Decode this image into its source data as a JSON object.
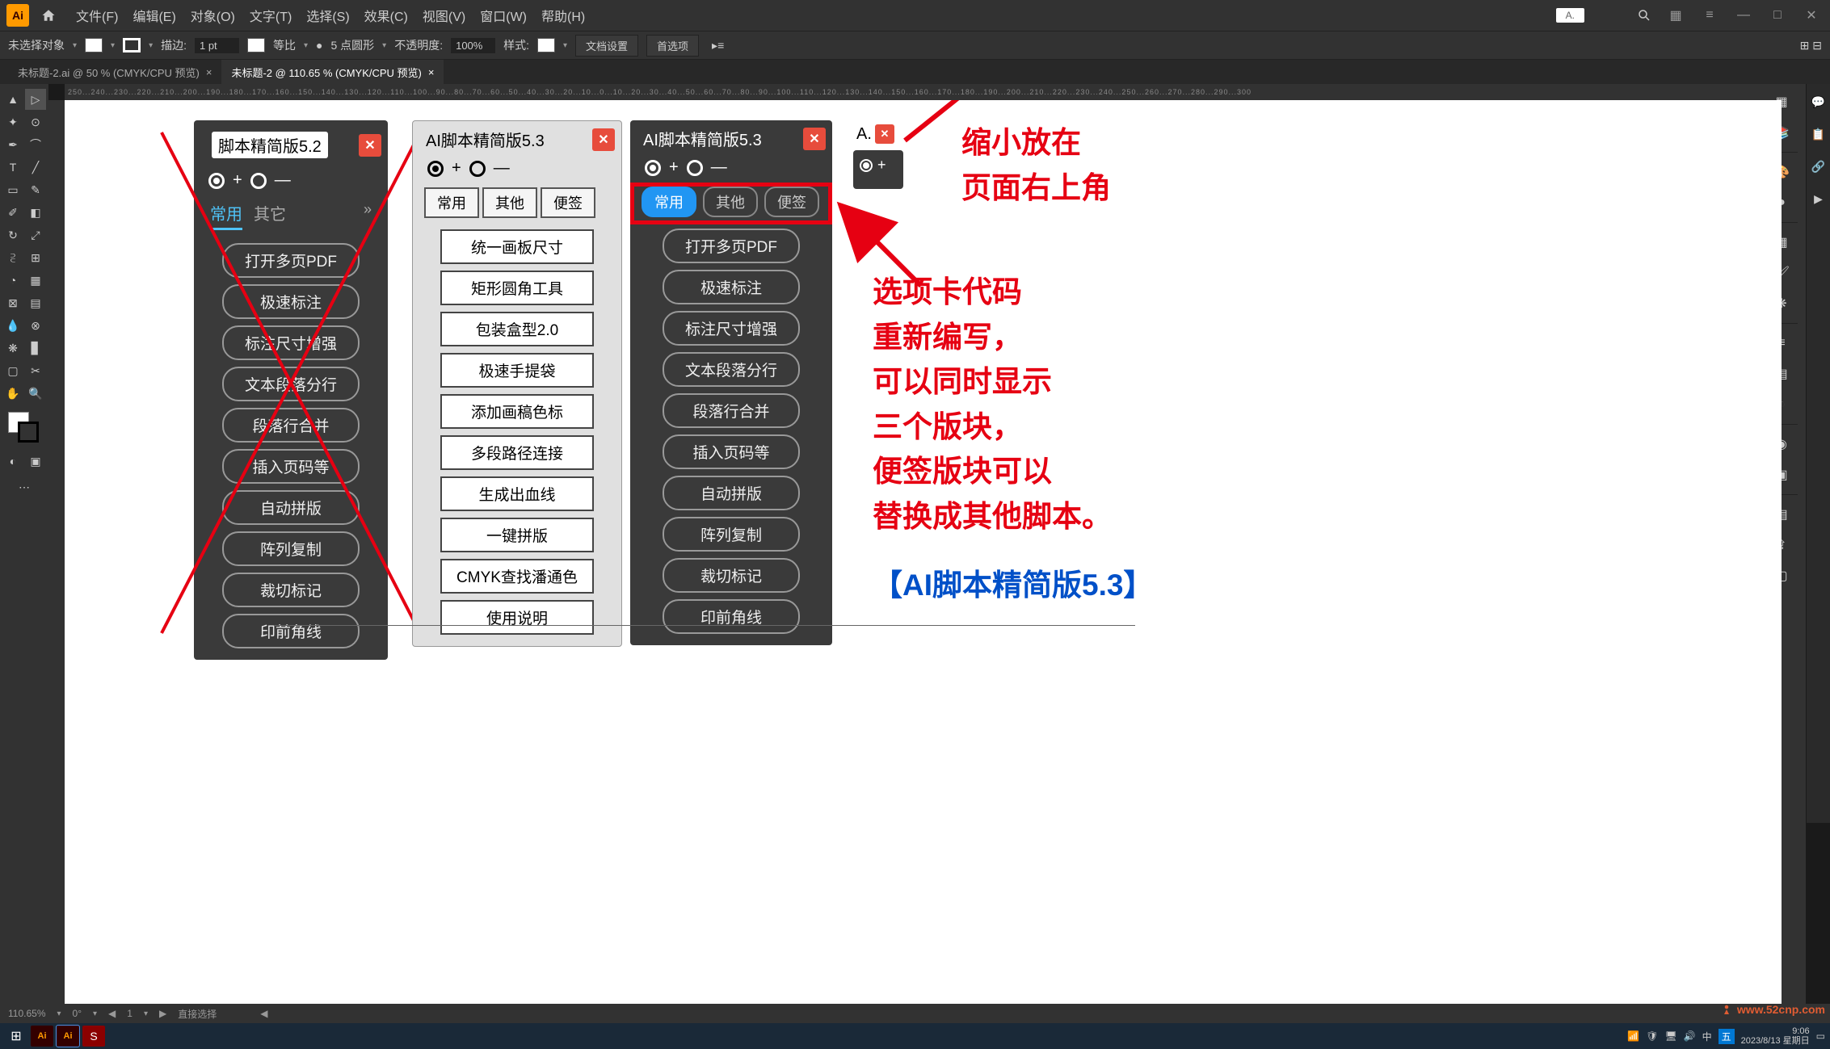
{
  "menubar": {
    "items": [
      "文件(F)",
      "编辑(E)",
      "对象(O)",
      "文字(T)",
      "选择(S)",
      "效果(C)",
      "视图(V)",
      "窗口(W)",
      "帮助(H)"
    ],
    "mini_label": "A."
  },
  "controlbar": {
    "noselection": "未选择对象",
    "stroke_label": "描边:",
    "stroke_val": "1 pt",
    "uniform": "等比",
    "brush_label": "5 点圆形",
    "opacity_label": "不透明度:",
    "opacity_val": "100%",
    "style_label": "样式:",
    "doc_settings": "文档设置",
    "prefs": "首选项"
  },
  "tabs": {
    "tab1": "未标题-2.ai @ 50 % (CMYK/CPU 预览)",
    "tab2": "未标题-2 @ 110.65 % (CMYK/CPU 预览)"
  },
  "ruler": "250...240...230...220...210...200...190...180...170...160...150...140...130...120...110...100...90...80...70...60...50...40...30...20...10...0...10...20...30...40...50...60...70...80...90...100...110...120...130...140...150...160...170...180...190...200...210...220...230...240...250...260...270...280...290...300",
  "panel52": {
    "title": "脚本精简版5.2",
    "tabs": [
      "常用",
      "其它"
    ],
    "buttons": [
      "打开多页PDF",
      "极速标注",
      "标注尺寸增强",
      "文本段落分行",
      "段落行合并",
      "插入页码等",
      "自动拼版",
      "阵列复制",
      "裁切标记",
      "印前角线"
    ]
  },
  "panel53light": {
    "title": "AI脚本精简版5.3",
    "tabs": [
      "常用",
      "其他",
      "便签"
    ],
    "buttons": [
      "统一画板尺寸",
      "矩形圆角工具",
      "包装盒型2.0",
      "极速手提袋",
      "添加画稿色标",
      "多段路径连接",
      "生成出血线",
      "一键拼版",
      "CMYK查找潘通色",
      "使用说明"
    ]
  },
  "panel53dark": {
    "title": "AI脚本精简版5.3",
    "tabs": [
      "常用",
      "其他",
      "便签"
    ],
    "buttons": [
      "打开多页PDF",
      "极速标注",
      "标注尺寸增强",
      "文本段落分行",
      "段落行合并",
      "插入页码等",
      "自动拼版",
      "阵列复制",
      "裁切标记",
      "印前角线"
    ]
  },
  "mini": {
    "title": "A."
  },
  "annotations": {
    "line1": "缩小放在",
    "line2": "页面右上角",
    "body": "选项卡代码\n重新编写，\n可以同时显示\n三个版块，\n便签版块可以\n替换成其他脚本。",
    "title": "【AI脚本精简版5.3】"
  },
  "statusbar": {
    "zoom": "110.65%",
    "rot": "0°",
    "artboard": "1",
    "mode": "直接选择"
  },
  "taskbar": {
    "time": "9:06",
    "date": "2023/8/13 星期日"
  },
  "watermark": "www.52cnp.com"
}
